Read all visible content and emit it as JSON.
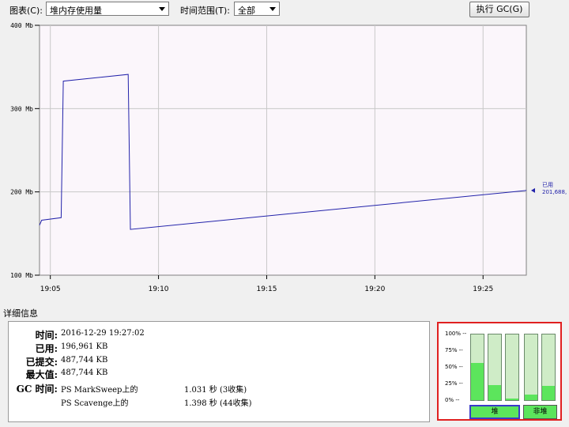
{
  "toolbar": {
    "chart_label": "图表(C):",
    "chart_value": "堆内存使用量",
    "range_label": "时间范围(T):",
    "range_value": "全部",
    "gc_button": "执行 GC(G)"
  },
  "chart_data": {
    "type": "line",
    "y_ticks": [
      "400 Mb",
      "300 Mb",
      "200 Mb",
      "100 Mb"
    ],
    "x_ticks": [
      "19:05",
      "19:10",
      "19:15",
      "19:20",
      "19:25"
    ],
    "ylim": [
      100,
      400
    ],
    "xlim": [
      "19:04.5",
      "19:27.0"
    ],
    "grid": true,
    "series": [
      {
        "color": "#2222aa",
        "x": [
          "19:04.5",
          "19:04.6",
          "19:05.5",
          "19:05.6",
          "19:08.6",
          "19:08.7",
          "19:27.0"
        ],
        "y": [
          160,
          166,
          169,
          333,
          341,
          155,
          201.7
        ]
      }
    ],
    "annotation": {
      "label": "已用",
      "value": "201,688,"
    }
  },
  "details": {
    "title": "详细信息",
    "time_label": "时间:",
    "time_value": "2016-12-29 19:27:02",
    "used_label": "已用:",
    "used_value": "196,961 KB",
    "committed_label": "已提交:",
    "committed_value": "487,744 KB",
    "max_label": "最大值:",
    "max_value": "487,744 KB",
    "gc_label": "GC 时间:",
    "gc_rows": [
      {
        "name": "PS MarkSweep上的",
        "time": "1.031 秒 (3收集)"
      },
      {
        "name": "PS Scavenge上的",
        "time": "1.398 秒 (44收集)"
      }
    ]
  },
  "pools": {
    "percent_labels": [
      "100% --",
      "75% --",
      "50% --",
      "25% --",
      "0% --"
    ],
    "heap_label": "堆",
    "nonheap_label": "非堆",
    "heap_levels": [
      0.57,
      0.23,
      0.02
    ],
    "nonheap_levels": [
      0.09,
      0.22
    ],
    "fill_color": "#5ce55c",
    "empty_color": "#cfecc7"
  }
}
